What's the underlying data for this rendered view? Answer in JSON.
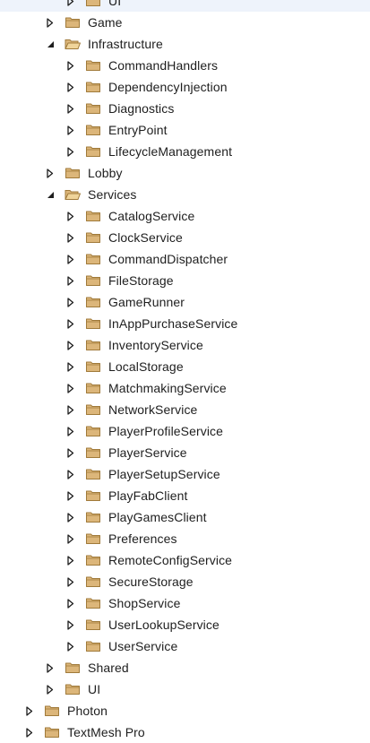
{
  "tree": {
    "rows": [
      {
        "label": "UI",
        "depth": 2,
        "expanded": false
      },
      {
        "label": "Game",
        "depth": 1,
        "expanded": false
      },
      {
        "label": "Infrastructure",
        "depth": 1,
        "expanded": true
      },
      {
        "label": "CommandHandlers",
        "depth": 2,
        "expanded": false
      },
      {
        "label": "DependencyInjection",
        "depth": 2,
        "expanded": false
      },
      {
        "label": "Diagnostics",
        "depth": 2,
        "expanded": false
      },
      {
        "label": "EntryPoint",
        "depth": 2,
        "expanded": false
      },
      {
        "label": "LifecycleManagement",
        "depth": 2,
        "expanded": false
      },
      {
        "label": "Lobby",
        "depth": 1,
        "expanded": false
      },
      {
        "label": "Services",
        "depth": 1,
        "expanded": true
      },
      {
        "label": "CatalogService",
        "depth": 2,
        "expanded": false
      },
      {
        "label": "ClockService",
        "depth": 2,
        "expanded": false
      },
      {
        "label": "CommandDispatcher",
        "depth": 2,
        "expanded": false
      },
      {
        "label": "FileStorage",
        "depth": 2,
        "expanded": false
      },
      {
        "label": "GameRunner",
        "depth": 2,
        "expanded": false
      },
      {
        "label": "InAppPurchaseService",
        "depth": 2,
        "expanded": false
      },
      {
        "label": "InventoryService",
        "depth": 2,
        "expanded": false
      },
      {
        "label": "LocalStorage",
        "depth": 2,
        "expanded": false
      },
      {
        "label": "MatchmakingService",
        "depth": 2,
        "expanded": false
      },
      {
        "label": "NetworkService",
        "depth": 2,
        "expanded": false
      },
      {
        "label": "PlayerProfileService",
        "depth": 2,
        "expanded": false
      },
      {
        "label": "PlayerService",
        "depth": 2,
        "expanded": false
      },
      {
        "label": "PlayerSetupService",
        "depth": 2,
        "expanded": false
      },
      {
        "label": "PlayFabClient",
        "depth": 2,
        "expanded": false
      },
      {
        "label": "PlayGamesClient",
        "depth": 2,
        "expanded": false
      },
      {
        "label": "Preferences",
        "depth": 2,
        "expanded": false
      },
      {
        "label": "RemoteConfigService",
        "depth": 2,
        "expanded": false
      },
      {
        "label": "SecureStorage",
        "depth": 2,
        "expanded": false
      },
      {
        "label": "ShopService",
        "depth": 2,
        "expanded": false
      },
      {
        "label": "UserLookupService",
        "depth": 2,
        "expanded": false
      },
      {
        "label": "UserService",
        "depth": 2,
        "expanded": false
      },
      {
        "label": "Shared",
        "depth": 1,
        "expanded": false
      },
      {
        "label": "UI",
        "depth": 1,
        "expanded": false
      },
      {
        "label": "Photon",
        "depth": 0,
        "expanded": false
      },
      {
        "label": "TextMesh Pro",
        "depth": 0,
        "expanded": false
      }
    ]
  },
  "icons": {
    "folder": "folder-icon",
    "collapsed": "chevron-right-icon",
    "expanded": "chevron-down-icon"
  },
  "colors": {
    "folder_fill": "#dcb67a",
    "folder_stroke": "#a07a3a",
    "arrow_collapsed": "#1e1e1e",
    "arrow_expanded": "#1e1e1e",
    "text": "#1e1e1e",
    "background": "#ffffff"
  }
}
